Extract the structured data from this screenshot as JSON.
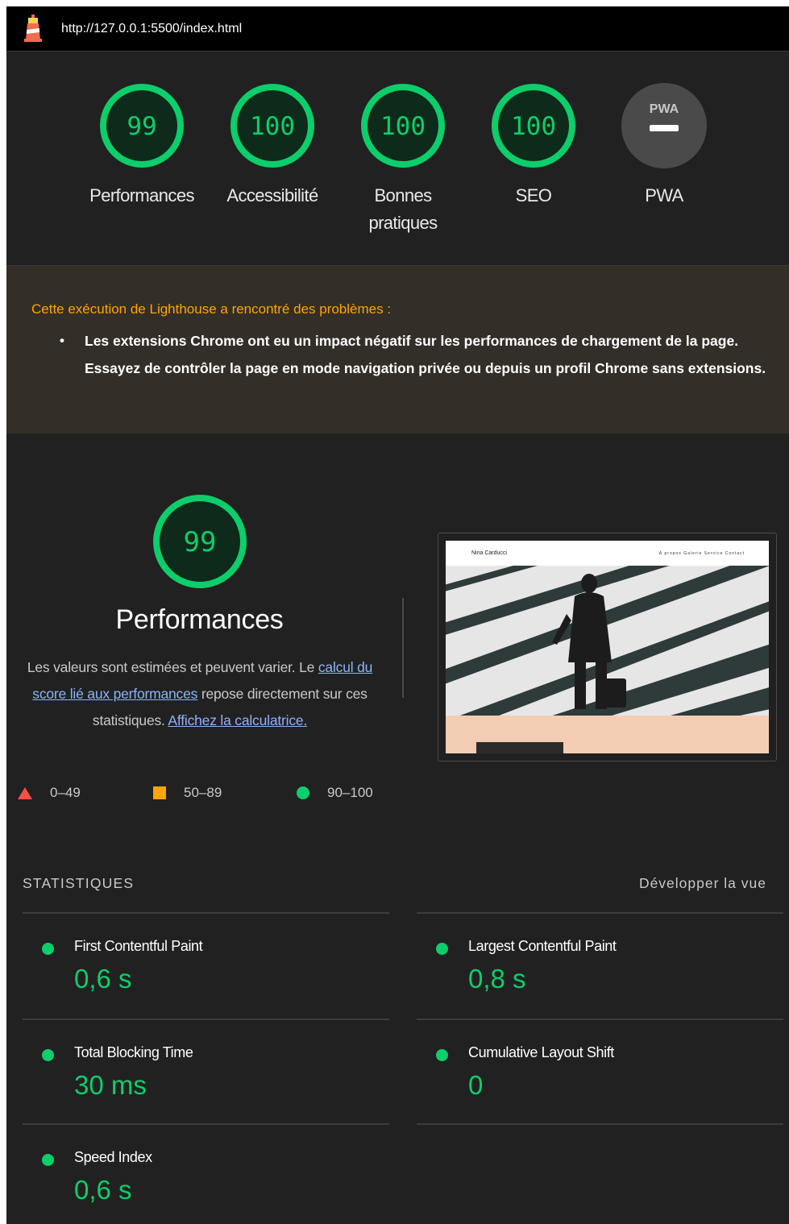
{
  "url": "http://127.0.0.1:5500/index.html",
  "gauges": [
    {
      "score": "99",
      "label": "Performances"
    },
    {
      "score": "100",
      "label": "Accessibilité"
    },
    {
      "score": "100",
      "label": "Bonnes",
      "label2": "pratiques"
    },
    {
      "score": "100",
      "label": "SEO"
    },
    {
      "score_text": "PWA",
      "label": "PWA"
    }
  ],
  "warning": {
    "title": "Cette exécution de Lighthouse a rencontré des problèmes :",
    "item": "Les extensions Chrome ont eu un impact négatif sur les performances de chargement de la page. Essayez de contrôler la page en mode navigation privée ou depuis un profil Chrome sans extensions."
  },
  "performance": {
    "score": "99",
    "title": "Performances",
    "desc_part1": "Les valeurs sont estimées et peuvent varier. Le ",
    "desc_link1": "calcul du score lié aux performances",
    "desc_part2": " repose directement sur ces statistiques. ",
    "desc_link2": "Affichez la calculatrice."
  },
  "legend": [
    {
      "shape": "triangle",
      "range": "0–49",
      "color": "#ff4e42"
    },
    {
      "shape": "square",
      "range": "50–89",
      "color": "#ffa400"
    },
    {
      "shape": "circle",
      "range": "90–100",
      "color": "#0cce6b"
    }
  ],
  "thumbnail": {
    "brand": "Nina Carducci",
    "links": "À propos  Galerie  Service  Contact"
  },
  "stats": {
    "heading": "STATISTIQUES",
    "toggle": "Développer la vue",
    "metrics": [
      {
        "name": "First Contentful Paint",
        "value": "0,6 s"
      },
      {
        "name": "Largest Contentful Paint",
        "value": "0,8 s"
      },
      {
        "name": "Total Blocking Time",
        "value": "30 ms"
      },
      {
        "name": "Cumulative Layout Shift",
        "value": "0"
      },
      {
        "name": "Speed Index",
        "value": "0,6 s"
      }
    ]
  },
  "colors": {
    "pass": "#0cce6b",
    "average": "#ffa400",
    "fail": "#ff4e42",
    "warning_text": "#ffa400"
  }
}
